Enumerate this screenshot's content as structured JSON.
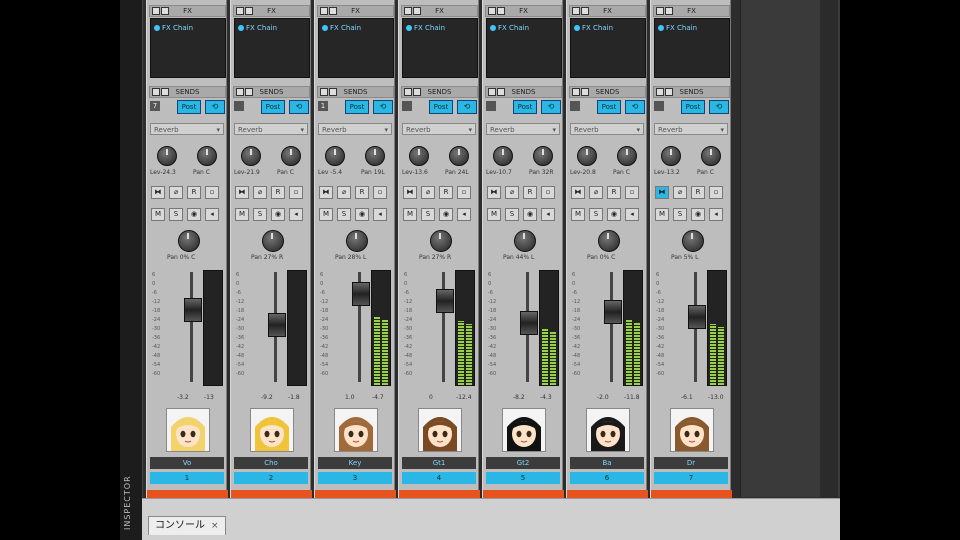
{
  "app": {
    "inspector_label": "INSPECTOR",
    "tab": {
      "label": "コンソール",
      "close": "×"
    },
    "section_labels": {
      "fx": "FX",
      "sends": "SENDS"
    },
    "fx_item": "FX Chain",
    "send_buttons": {
      "post": "Post",
      "cycle": "⟲"
    },
    "reverb_label": "Reverb",
    "button_labels": {
      "phase": "⧓",
      "mute": "M",
      "solo": "S",
      "record": "R"
    },
    "pan_prefix": "Pan"
  },
  "channels": [
    {
      "name": "Vo",
      "number": "1",
      "send_num": "7",
      "send_lev": "Lev-24.3",
      "send_pan": "Pan  C",
      "pan": "Pan  0%  C",
      "fader_db": "-3.2",
      "peak": "-13",
      "fader_pos": 0.3,
      "meter": 0.0,
      "avatar_hair": "#f2d36b",
      "avatar_skin": "#ffe3c8"
    },
    {
      "name": "Cho",
      "number": "2",
      "send_num": "",
      "send_lev": "Lev-21.9",
      "send_pan": "Pan  C",
      "pan": "Pan 27%  R",
      "fader_db": "-9.2",
      "peak": "-1.8",
      "fader_pos": 0.48,
      "meter": 0.0,
      "avatar_hair": "#f0c43a",
      "avatar_skin": "#ffe3c8"
    },
    {
      "name": "Key",
      "number": "3",
      "send_num": "1",
      "send_lev": "Lev -5.4",
      "send_pan": "Pan  19L",
      "pan": "Pan 28%  L",
      "fader_db": "1.0",
      "peak": "-4.7",
      "fader_pos": 0.12,
      "meter": 0.62,
      "avatar_hair": "#a06a3a",
      "avatar_skin": "#ffe3c8"
    },
    {
      "name": "Gt1",
      "number": "4",
      "send_num": "",
      "send_lev": "Lev-13.6",
      "send_pan": "Pan  24L",
      "pan": "Pan 27%  R",
      "fader_db": "0",
      "peak": "-12.4",
      "fader_pos": 0.2,
      "meter": 0.58,
      "avatar_hair": "#7a4a24",
      "avatar_skin": "#ffe3c8"
    },
    {
      "name": "Gt2",
      "number": "5",
      "send_num": "",
      "send_lev": "Lev-10.7",
      "send_pan": "Pan  32R",
      "pan": "Pan 44%  L",
      "fader_db": "-8.2",
      "peak": "-4.3",
      "fader_pos": 0.45,
      "meter": 0.52,
      "avatar_hair": "#111111",
      "avatar_skin": "#ffe3c8"
    },
    {
      "name": "Ba",
      "number": "6",
      "send_num": "",
      "send_lev": "Lev-20.8",
      "send_pan": "Pan  C",
      "pan": "Pan  0%  C",
      "fader_db": "-2.0",
      "peak": "-11.8",
      "fader_pos": 0.33,
      "meter": 0.6,
      "avatar_hair": "#1a1a1a",
      "avatar_skin": "#ffe3c8"
    },
    {
      "name": "Dr",
      "number": "7",
      "send_num": "",
      "send_lev": "Lev-13.2",
      "send_pan": "Pan  C",
      "pan": "Pan  5%  L",
      "fader_db": "-6.1",
      "peak": "-13.0",
      "fader_pos": 0.38,
      "meter": 0.55,
      "avatar_hair": "#8a5a2e",
      "avatar_skin": "#ffe3c8"
    }
  ],
  "colors": {
    "accent": "#2ab7e6",
    "orange": "#e6531f",
    "meter": "#9ad14a"
  }
}
